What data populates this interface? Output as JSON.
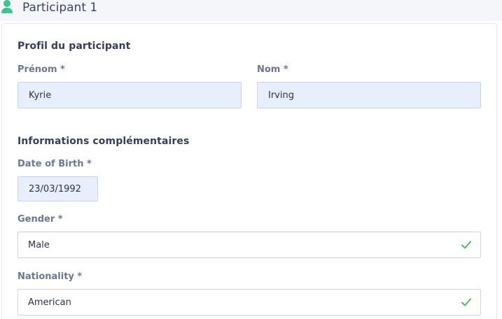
{
  "header": {
    "title": "Participant 1",
    "icon": "person-icon",
    "icon_color": "#3ec28f"
  },
  "profile": {
    "section_title": "Profil du participant",
    "first_name": {
      "label": "Prénom *",
      "value": "Kyrie"
    },
    "last_name": {
      "label": "Nom *",
      "value": "Irving"
    }
  },
  "extra": {
    "section_title": "Informations complémentaires",
    "dob": {
      "label": "Date of Birth *",
      "value": "23/03/1992"
    },
    "gender": {
      "label": "Gender *",
      "value": "Male",
      "valid_icon": "check-icon"
    },
    "nationality": {
      "label": "Nationality *",
      "value": "American",
      "valid_icon": "check-icon"
    }
  },
  "colors": {
    "valid": "#4cba6b",
    "filled_input_bg": "#e8eefc"
  }
}
